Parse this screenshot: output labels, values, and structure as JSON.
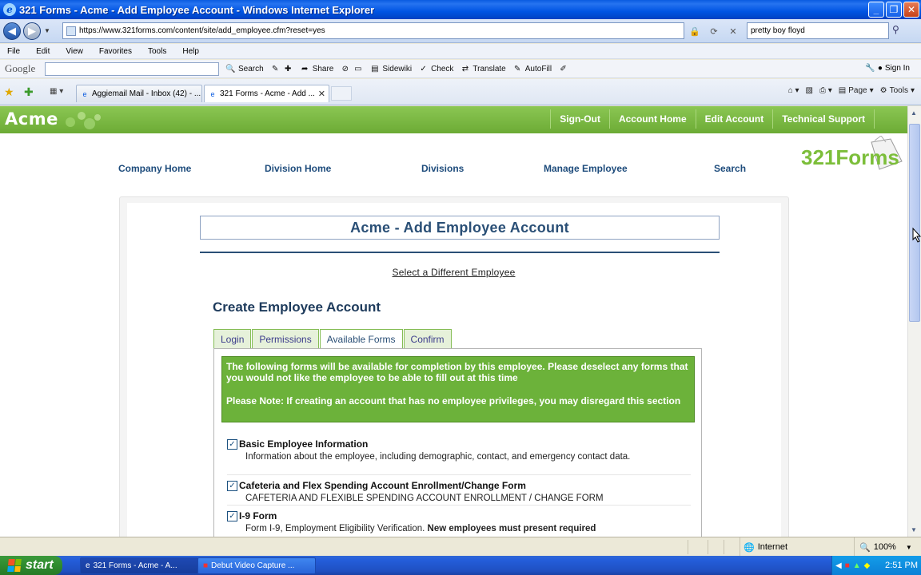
{
  "window": {
    "title": "321 Forms - Acme - Add Employee Account - Windows Internet Explorer"
  },
  "address_bar": {
    "url": "https://www.321forms.com/content/site/add_employee.cfm?reset=yes",
    "search_value": "pretty boy floyd"
  },
  "menu": [
    "File",
    "Edit",
    "View",
    "Favorites",
    "Tools",
    "Help"
  ],
  "google_toolbar": {
    "logo": "Google",
    "items": [
      "Search",
      "Share",
      "Sidewiki",
      "Check",
      "Translate",
      "AutoFill"
    ],
    "sign_in": "Sign In"
  },
  "tabs": [
    {
      "label": "Aggiemail Mail - Inbox (42) - ..."
    },
    {
      "label": "321 Forms - Acme - Add ..."
    }
  ],
  "command_bar": {
    "page": "Page",
    "tools": "Tools"
  },
  "site": {
    "logo": "Acme",
    "header_links": [
      "Sign-Out",
      "Account Home",
      "Edit Account",
      "Technical Support"
    ],
    "nav": [
      "Company Home",
      "Division Home",
      "Divisions",
      "Manage Employee",
      "Search"
    ],
    "brand": "321Forms",
    "page_heading": "Acme - Add Employee Account",
    "select_link": "Select a Different Employee",
    "section_title": "Create Employee Account",
    "form_tabs": [
      "Login",
      "Permissions",
      "Available Forms",
      "Confirm"
    ],
    "active_tab": "Available Forms",
    "notice_1": "The following forms will be available for completion by this employee. Please deselect any forms that you would not like the employee to be able to fill out at this time",
    "notice_2": "Please Note: If creating an account that has no employee privileges, you may disregard this section",
    "forms": [
      {
        "name": "Basic Employee Information",
        "desc": "Information about the employee, including demographic, contact, and emergency contact data.",
        "checked": true
      },
      {
        "name": "Cafeteria and Flex Spending Account Enrollment/Change Form",
        "desc": "CAFETERIA AND FLEXIBLE SPENDING ACCOUNT ENROLLMENT / CHANGE FORM",
        "checked": true
      },
      {
        "name": "I-9 Form",
        "desc": "Form I-9, Employment Eligibility Verification.",
        "desc_bold": "New employees must present required",
        "checked": true
      }
    ]
  },
  "status_bar": {
    "zone": "Internet",
    "zoom": "100%"
  },
  "taskbar": {
    "start": "start",
    "tasks": [
      "321 Forms - Acme - A...",
      "Debut Video Capture ..."
    ],
    "clock": "2:51 PM"
  },
  "colors": {
    "site_green": "#6cab35",
    "heading_blue": "#2a4f76",
    "notice_green": "#6cb23a"
  }
}
